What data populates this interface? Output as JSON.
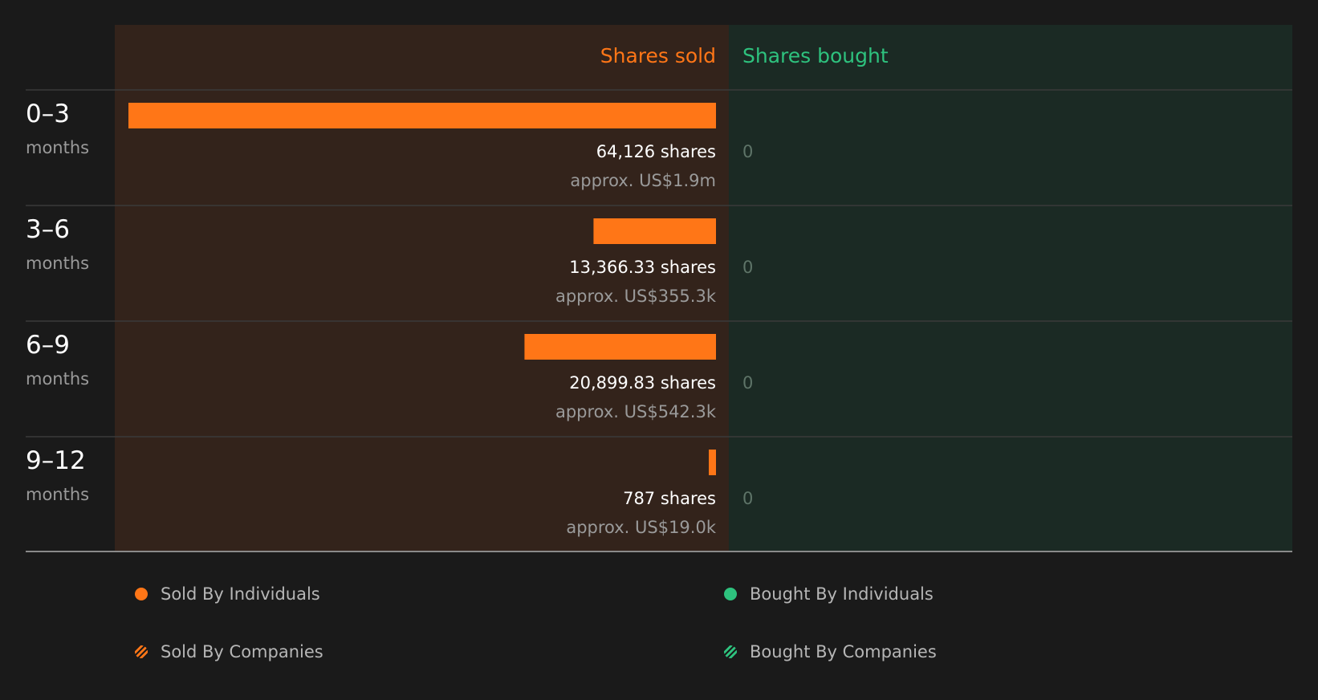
{
  "chart_data": {
    "type": "bar",
    "orientation": "horizontal-diverging",
    "headers": {
      "sold": "Shares sold",
      "bought": "Shares bought"
    },
    "categories": [
      {
        "range": "0–3",
        "unit": "months"
      },
      {
        "range": "3–6",
        "unit": "months"
      },
      {
        "range": "6–9",
        "unit": "months"
      },
      {
        "range": "9–12",
        "unit": "months"
      }
    ],
    "series": [
      {
        "name": "Shares sold",
        "values": [
          64126,
          13366.33,
          20899.83,
          787
        ],
        "value_labels": [
          "64,126 shares",
          "13,366.33 shares",
          "20,899.83 shares",
          "787 shares"
        ],
        "approx_labels": [
          "approx. US$1.9m",
          "approx. US$355.3k",
          "approx. US$542.3k",
          "approx. US$19.0k"
        ]
      },
      {
        "name": "Shares bought",
        "values": [
          0,
          0,
          0,
          0
        ],
        "value_labels": [
          "0",
          "0",
          "0",
          "0"
        ]
      }
    ],
    "legend": {
      "placement": "bottom",
      "items": [
        {
          "label": "Sold By Individuals",
          "marker": "dot",
          "color": "#ff7617"
        },
        {
          "label": "Bought By Individuals",
          "marker": "dot",
          "color": "#2ec27e"
        },
        {
          "label": "Sold By Companies",
          "marker": "hatched-dot",
          "color": "#ff7617"
        },
        {
          "label": "Bought By Companies",
          "marker": "hatched-dot",
          "color": "#2ec27e"
        }
      ]
    },
    "colors": {
      "sold": "#ff7617",
      "bought": "#2ec27e",
      "sold_panel": "#33231b",
      "bought_panel": "#1b2a24",
      "background": "#1a1a1a"
    }
  }
}
